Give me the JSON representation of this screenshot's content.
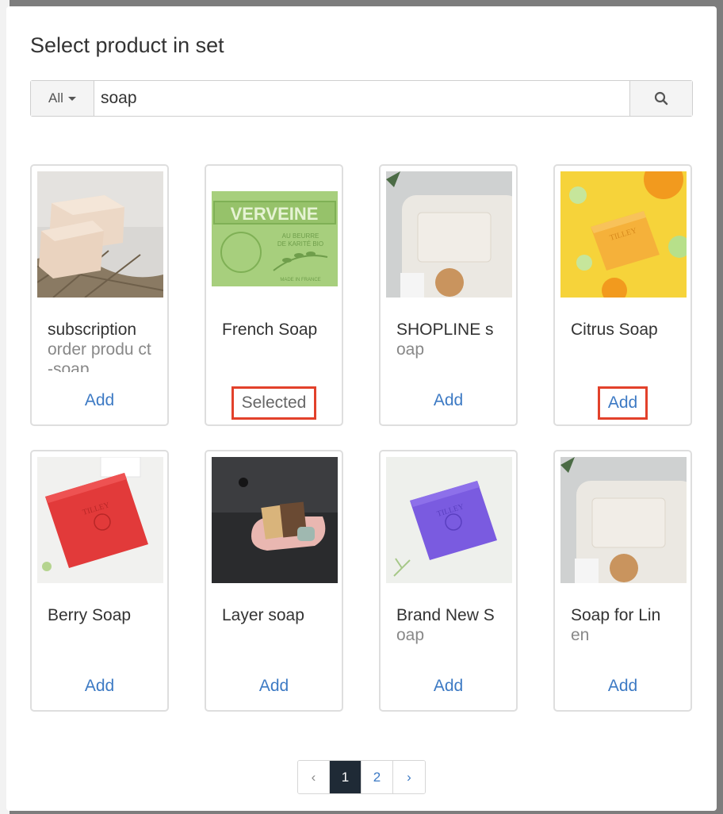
{
  "modal": {
    "title": "Select product in set"
  },
  "search": {
    "filter_label": "All",
    "query": "soap",
    "search_icon": "search-icon"
  },
  "products": [
    {
      "name_line1": "subscription",
      "name_rest": "order produ ct-soap",
      "action": "Add",
      "image": "stacked-beige-soap-bars-on-net"
    },
    {
      "name_line1": "French Soap",
      "name_rest": "",
      "action": "Selected",
      "image": "green-verveine-soap-bar",
      "image_text": {
        "brand": "VERVEINE",
        "sub1": "AU BEURRE",
        "sub2": "DE KARITÉ BIO",
        "made": "MADE IN FRANCE"
      }
    },
    {
      "name_line1": "SHOPLINE s",
      "name_rest": "oap",
      "action": "Add",
      "image": "white-soap-on-towel-with-brush"
    },
    {
      "name_line1": "Citrus Soap",
      "name_rest": "",
      "action": "Add",
      "image": "yellow-soap-with-citrus-slices",
      "image_text": {
        "brand": "TILLEY"
      }
    },
    {
      "name_line1": "Berry Soap",
      "name_rest": "",
      "action": "Add",
      "image": "red-soap-bar",
      "image_text": {
        "brand": "TILLEY"
      }
    },
    {
      "name_line1": "Layer soap",
      "name_rest": "",
      "action": "Add",
      "image": "layered-soaps-in-dish"
    },
    {
      "name_line1": "Brand New S",
      "name_rest": "oap",
      "action": "Add",
      "image": "purple-soap-bar",
      "image_text": {
        "brand": "TILLEY"
      }
    },
    {
      "name_line1": "Soap for Lin",
      "name_rest": "en",
      "action": "Add",
      "image": "white-soap-on-towel-with-brush"
    }
  ],
  "highlighted_actions": [
    1,
    3
  ],
  "pagination": {
    "prev": "‹",
    "pages": [
      "1",
      "2"
    ],
    "current": "1",
    "next": "›"
  },
  "colors": {
    "link": "#3d7ac4",
    "highlight": "#e2412b",
    "active_page": "#1f2a36"
  }
}
